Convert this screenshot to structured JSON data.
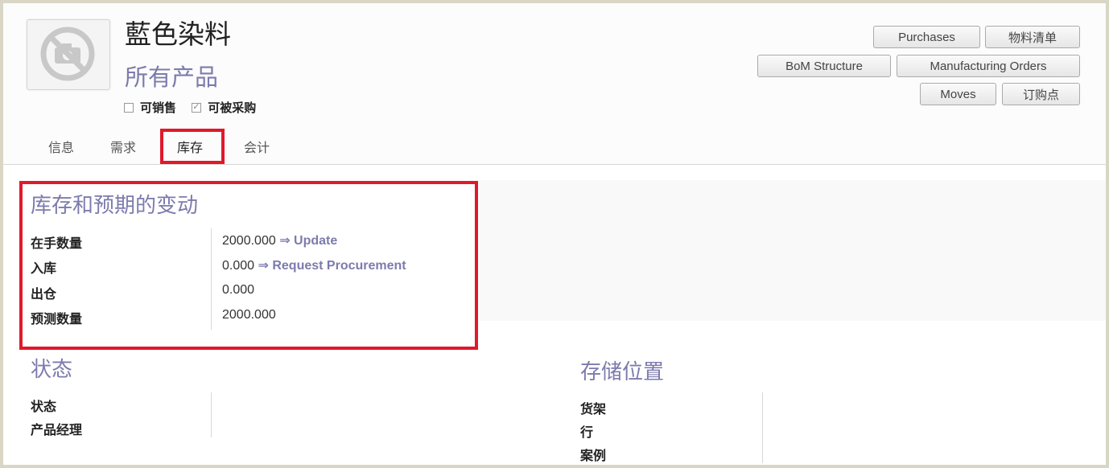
{
  "product": {
    "name": "藍色染料",
    "category": "所有产品",
    "flags": [
      {
        "label": "可销售",
        "checked": false
      },
      {
        "label": "可被采购",
        "checked": true
      }
    ]
  },
  "actions": {
    "purchases": "Purchases",
    "bom": "物料清单",
    "bom_structure": "BoM Structure",
    "manufacturing_orders": "Manufacturing Orders",
    "moves": "Moves",
    "reorder": "订购点"
  },
  "tabs": [
    {
      "label": "信息",
      "active": false
    },
    {
      "label": "需求",
      "active": false
    },
    {
      "label": "库存",
      "active": true
    },
    {
      "label": "会计",
      "active": false
    }
  ],
  "stock": {
    "title": "库存和预期的变动",
    "rows": [
      {
        "label": "在手数量",
        "value": "2000.000",
        "link": "⇒ Update"
      },
      {
        "label": "入库",
        "value": "0.000",
        "link": "⇒ Request Procurement"
      },
      {
        "label": "出仓",
        "value": "0.000",
        "link": ""
      },
      {
        "label": "预测数量",
        "value": "2000.000",
        "link": ""
      }
    ]
  },
  "status": {
    "title": "状态",
    "labels": [
      "状态",
      "产品经理"
    ]
  },
  "storage": {
    "title": "存储位置",
    "labels": [
      "货架",
      "行",
      "案例"
    ]
  },
  "colors": {
    "accent": "#7c7bad",
    "highlight": "#e0192b"
  }
}
